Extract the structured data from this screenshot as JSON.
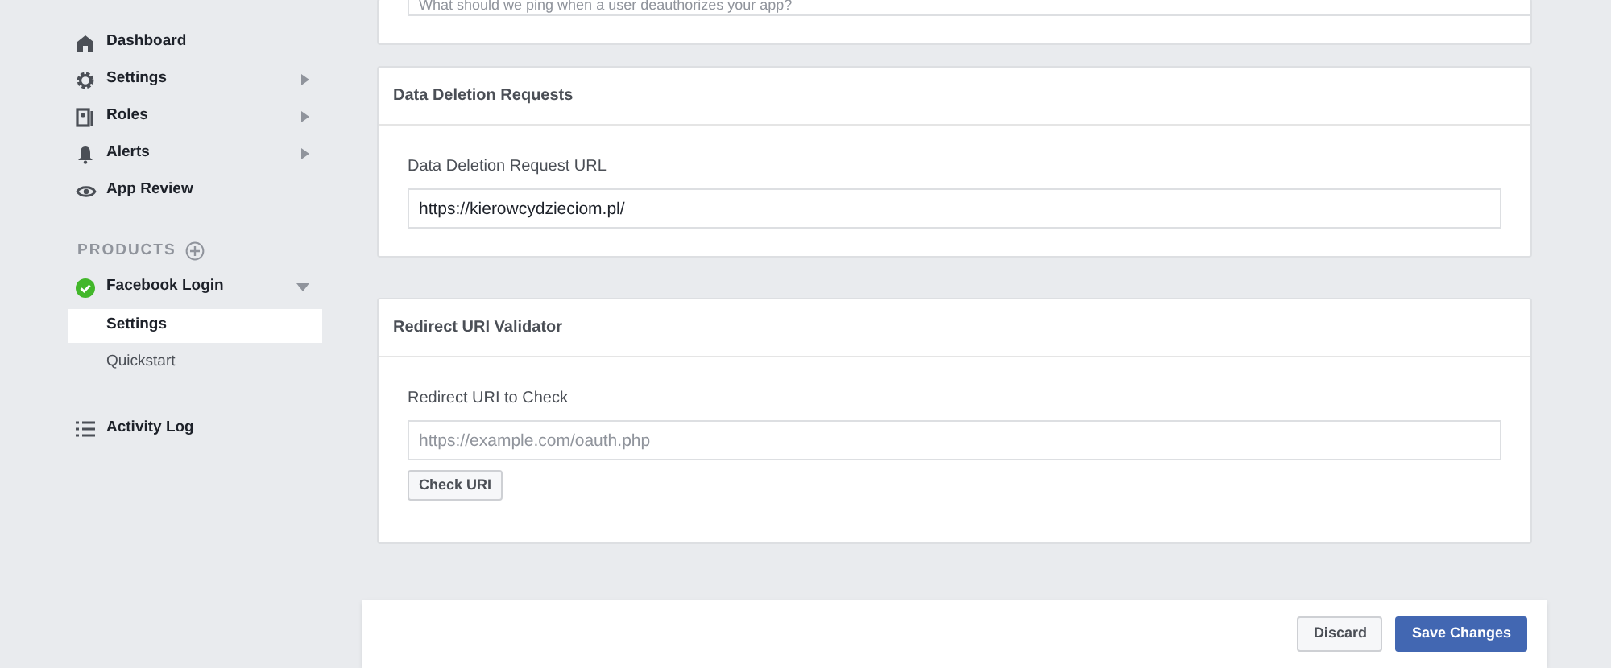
{
  "sidebar": {
    "items": [
      {
        "label": "Dashboard",
        "kind": "home",
        "submenu": false
      },
      {
        "label": "Settings",
        "kind": "settings",
        "submenu": true
      },
      {
        "label": "Roles",
        "kind": "roles",
        "submenu": true
      },
      {
        "label": "Alerts",
        "kind": "alerts",
        "submenu": true
      },
      {
        "label": "App Review",
        "kind": "review",
        "submenu": false
      }
    ],
    "products_heading": "PRODUCTS",
    "products": [
      {
        "name": "Facebook Login",
        "expanded": true,
        "children": [
          {
            "label": "Settings",
            "selected": true
          },
          {
            "label": "Quickstart",
            "selected": false
          }
        ]
      }
    ],
    "footer_item": {
      "label": "Activity Log"
    }
  },
  "sections": [
    {
      "kind": "partial",
      "field": {
        "placeholder": "What should we ping when a user deauthorizes your app?"
      }
    },
    {
      "kind": "form",
      "title": "Data Deletion Requests",
      "field_label": "Data Deletion Request URL",
      "field": {
        "value": "https://kierowcydzieciom.pl/"
      }
    },
    {
      "kind": "form",
      "title": "Redirect URI Validator",
      "field_label": "Redirect URI to Check",
      "field": {
        "placeholder": "https://example.com/oauth.php"
      },
      "button": "Check URI"
    }
  ],
  "footer": {
    "buttons": [
      {
        "label": "Discard",
        "primary": false
      },
      {
        "label": "Save Changes",
        "primary": true
      }
    ]
  }
}
